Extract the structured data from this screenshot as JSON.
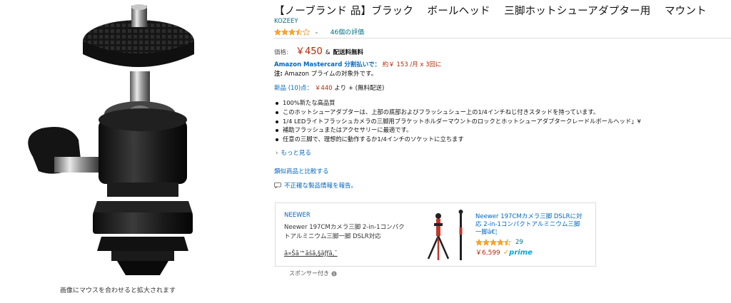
{
  "image_area": {
    "zoom_hint": "画像にマウスを合わせると拡大されます"
  },
  "product": {
    "title": "【ノーブランド 品】ブラック　 ボールヘッド　 三脚ホットシューアダプター用　 マウント",
    "brand": "KOZEEY",
    "rating_stars": 3.5,
    "rating_count": "46個の評価",
    "price_label": "価格:",
    "price": "￥450",
    "shipping_prefix": "&",
    "shipping": "配送料無料",
    "installment_link": "Amazon Mastercard 分割払いで：",
    "installment_detail": "約￥ 153 /月 x 3回に",
    "note_label": "注:",
    "note_text": "Amazon プライムの対象外です。",
    "new_offers_link": "新品 (10)点：",
    "new_offers_price": "￥440",
    "new_offers_suffix": "より + (無料配送)",
    "bullets": [
      "100%新たな高品質",
      "このホットシューアダプターは、上部の底部およびフラッシュシュー上の1/4インチねじ付きスタッドを持っています。",
      "1/4 LEDライトフラッシュカメラの三脚用ブラケットホルダーマウントのロックとホットシューアダプタークレードルボールヘッド」¥",
      "補助フラッシュまたはアクセサリーに最適です。",
      "任意の三脚で、理想的に動作するか1/4インチのソケットに立ちます"
    ],
    "see_more": "もっと見る",
    "compare": "類似商品と比較する",
    "report": "不正確な製品情報を報告。"
  },
  "ad": {
    "brand": "NEEWER",
    "description": "Neewer 197CMカメラ三脚 2-in-1コンパクトアルミニウム三脚一脚 DSLR対応",
    "garbled": "ã»Šã™ãšã‚§ãƒƒã‚¯",
    "title": "Neewer 197CMカメラ三脚 DSLRに対応 2-in-1コンパクトアルミニウム三脚一脚â€¦",
    "rating_stars": 4.5,
    "rating_count": "29",
    "price": "￥6,599",
    "prime_label": "prime",
    "sponsored": "スポンサー付き"
  },
  "colors": {
    "link": "#0066c0",
    "price_red": "#B12704",
    "star": "#FFA41C",
    "prime_blue": "#00A8E1"
  }
}
